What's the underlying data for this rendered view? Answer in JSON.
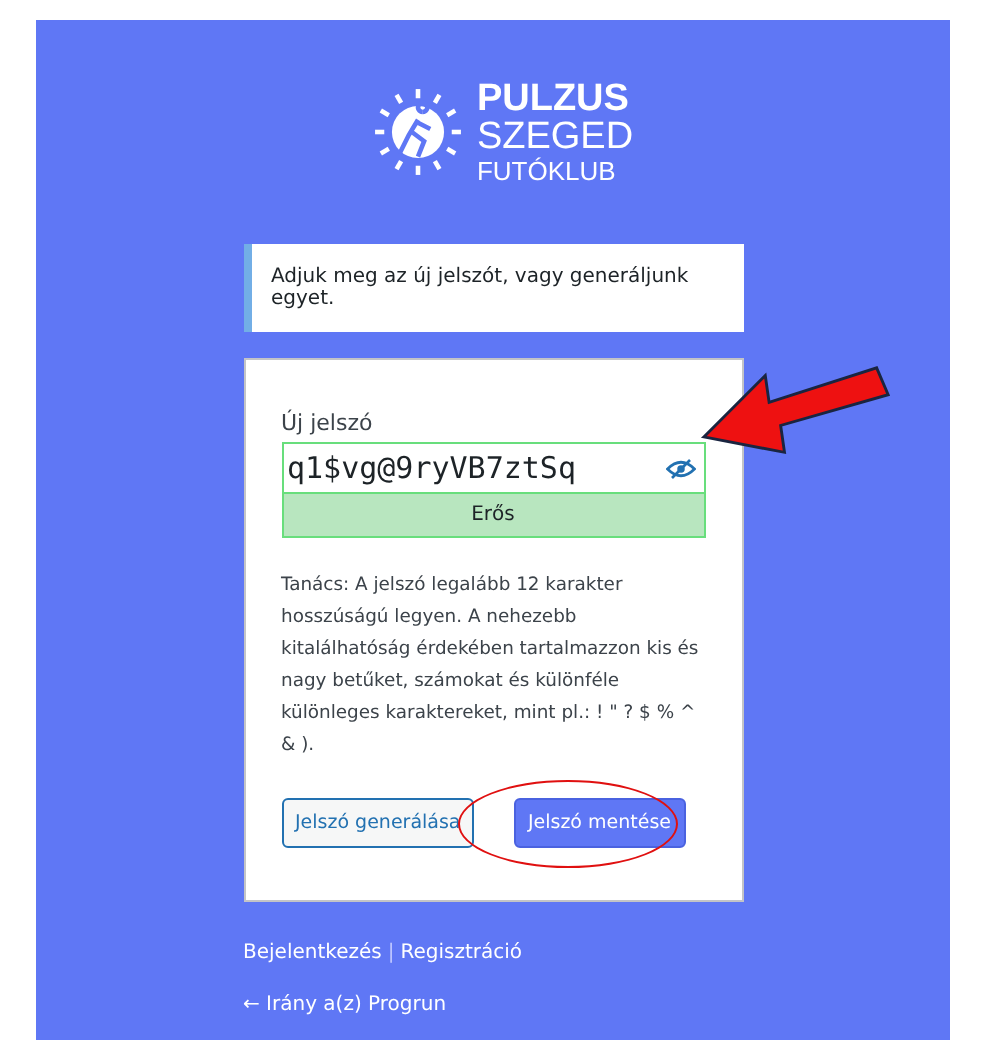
{
  "logo": {
    "lines": [
      "PULZUS",
      "SZEGED",
      "FUTÓKLUB"
    ]
  },
  "message": "Adjuk meg az új jelszót, vagy generáljunk egyet.",
  "form": {
    "label": "Új jelszó",
    "value": "q1$vg@9ryVB7ztSq",
    "strength": "Erős",
    "hint": "Tanács: A jelszó legalább 12 karakter hosszúságú legyen. A nehezebb kitalálhatóság érdekében tartalmazzon kis és nagy betűket, számokat és különféle különleges karaktereket, mint pl.: ! \" ? $ % ^ & ).",
    "buttons": [
      {
        "label": "Jelszó generálása",
        "kind": "secondary"
      },
      {
        "label": "Jelszó mentése",
        "kind": "primary"
      }
    ]
  },
  "nav": {
    "links": [
      "Bejelentkezés",
      "Regisztráció"
    ],
    "separator": "|",
    "back": "← Irány a(z) Progrun"
  }
}
